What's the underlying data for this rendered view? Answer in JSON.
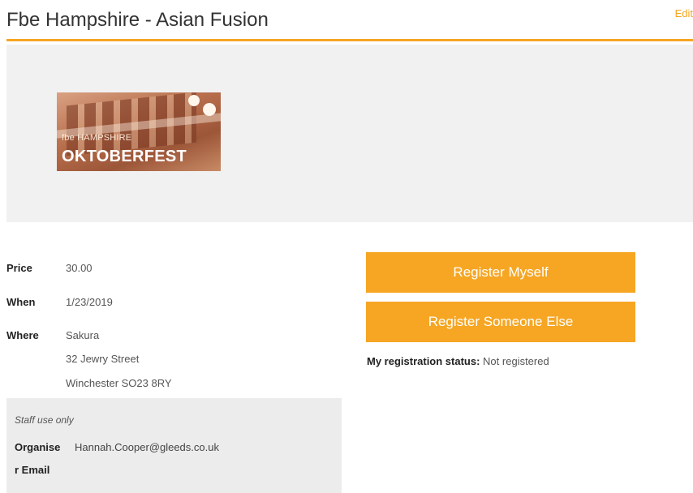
{
  "header": {
    "title": "Fbe Hampshire - Asian Fusion",
    "edit_label": "Edit"
  },
  "banner": {
    "image_line1": "fbe HAMPSHIRE",
    "image_line2": "OKTOBERFEST"
  },
  "details": {
    "price_label": "Price",
    "price_value": "30.00",
    "when_label": "When",
    "when_value": "1/23/2019",
    "where_label": "Where",
    "where_lines": [
      "Sakura",
      "32 Jewry Street",
      "Winchester SO23 8RY"
    ]
  },
  "staff": {
    "note": "Staff use only",
    "organiser_label_line1": "Organise",
    "organiser_label_line2": "r Email",
    "organiser_email": "Hannah.Cooper@gleeds.co.uk"
  },
  "actions": {
    "register_myself": "Register Myself",
    "register_someone_else": "Register Someone Else"
  },
  "registration": {
    "status_label": "My registration status:",
    "status_value": "Not registered"
  },
  "colors": {
    "accent": "#f6a623",
    "banner_bg": "#f1f1f1",
    "staff_bg": "#ececec"
  }
}
